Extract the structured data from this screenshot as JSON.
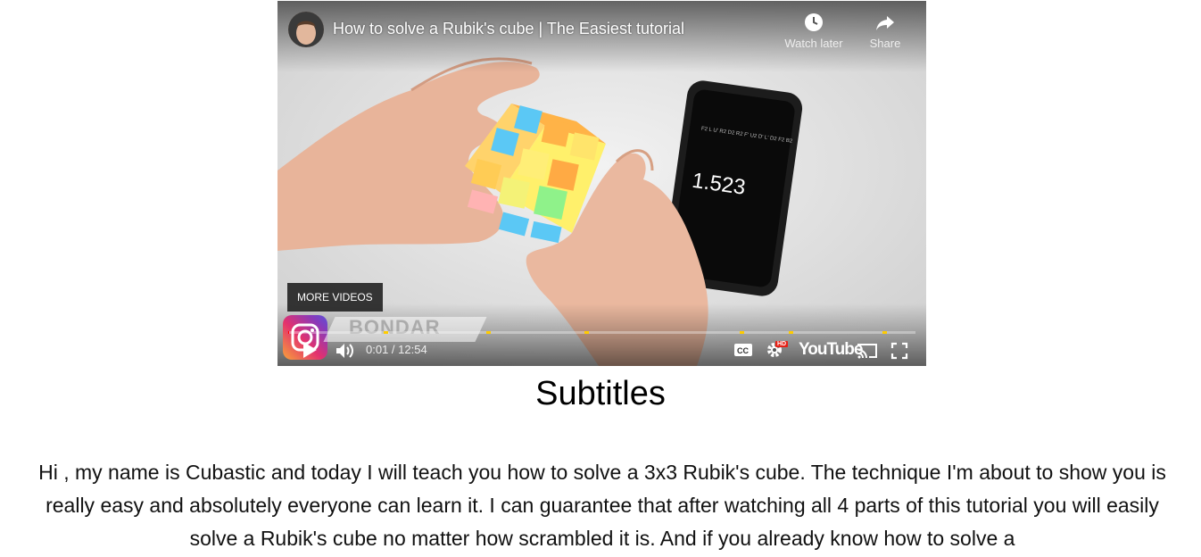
{
  "video": {
    "title": "How to solve a Rubik's cube | The Easiest tutorial",
    "watch_later_label": "Watch later",
    "share_label": "Share",
    "more_videos_label": "MORE VIDEOS",
    "watermark_text": "BONDAR",
    "phone_timer": "1.523",
    "time_display": "0:01 / 12:54",
    "progress_fraction": 0.0013,
    "brand_label": "YouTube",
    "hd_badge": "HD",
    "icons": {
      "avatar": "channel-avatar",
      "watch_later": "clock-icon",
      "share": "share-arrow-icon",
      "play": "play-icon",
      "volume": "volume-icon",
      "captions": "captions-icon",
      "settings": "gear-icon",
      "cast": "cast-icon",
      "fullscreen": "fullscreen-icon",
      "instagram": "instagram-icon"
    },
    "colors": {
      "progress_played": "#ff0000",
      "chapter_marker": "#ffcc00",
      "hd_badge": "#e62117"
    }
  },
  "page": {
    "heading": "Subtitles",
    "transcript": "Hi , my name is Cubastic and today I will teach you how to solve a 3x3 Rubik's cube. The technique I'm about to show you is really easy and absolutely everyone can learn it. I can guarantee that after watching all 4 parts of this tutorial you will easily solve a Rubik's cube no matter how scrambled it is. And if you already know how to solve a"
  }
}
